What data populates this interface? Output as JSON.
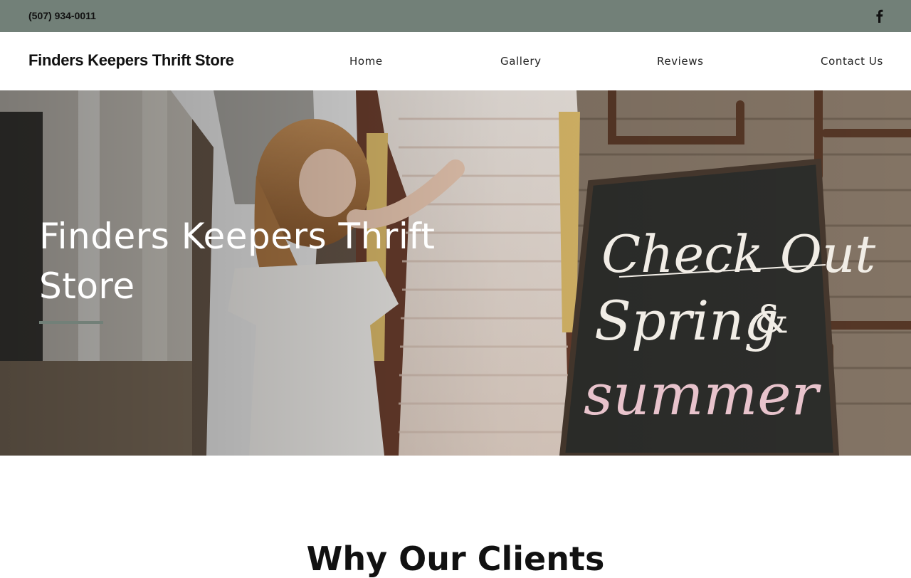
{
  "topbar": {
    "phone": "(507) 934-0011",
    "social_icon": "facebook-icon",
    "background": "#728078"
  },
  "header": {
    "brand": "Finders Keepers Thrift Store",
    "nav": [
      {
        "label": "Home"
      },
      {
        "label": "Gallery"
      },
      {
        "label": "Reviews"
      },
      {
        "label": "Contact Us"
      }
    ]
  },
  "hero": {
    "title": "Finders Keepers Thrift Store",
    "chalkboard": {
      "line1": "Check Out",
      "line2": "Spring",
      "amp": "&",
      "line3": "summer"
    },
    "accent": "#728078"
  },
  "section": {
    "heading": "Why Our Clients"
  }
}
